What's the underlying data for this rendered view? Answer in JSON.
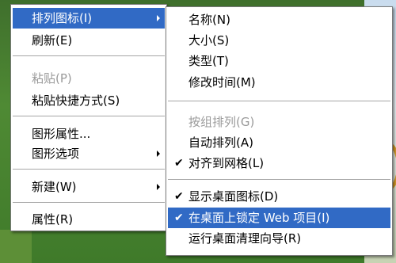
{
  "main_menu": {
    "items": [
      {
        "label": "排列图标(I)",
        "submenu": true,
        "highlighted": true
      },
      {
        "label": "刷新(E)"
      },
      {
        "label": "粘贴(P)",
        "disabled": true
      },
      {
        "label": "粘贴快捷方式(S)"
      },
      {
        "label": "图形属性..."
      },
      {
        "label": "图形选项",
        "submenu": true
      },
      {
        "label": "新建(W)",
        "submenu": true
      },
      {
        "label": "属性(R)"
      }
    ]
  },
  "sub_menu": {
    "items": [
      {
        "label": "名称(N)"
      },
      {
        "label": "大小(S)"
      },
      {
        "label": "类型(T)"
      },
      {
        "label": "修改时间(M)"
      },
      {
        "label": "按组排列(G)",
        "disabled": true
      },
      {
        "label": "自动排列(A)"
      },
      {
        "label": "对齐到网格(L)",
        "checked": true
      },
      {
        "label": "显示桌面图标(D)",
        "checked": true
      },
      {
        "label": "在桌面上锁定 Web 项目(I)",
        "checked": true,
        "highlighted": true
      },
      {
        "label": "运行桌面清理向导(R)"
      }
    ]
  },
  "icons": {
    "check": "✔"
  },
  "colors": {
    "highlight": "#316ac5",
    "disabled_text": "#9a9a9a"
  }
}
